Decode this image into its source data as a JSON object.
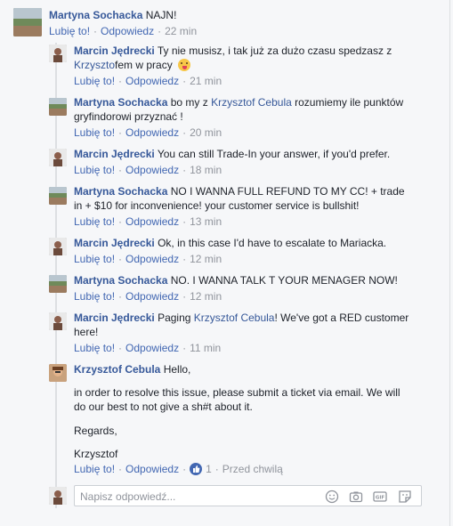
{
  "actions": {
    "like": "Lubię to!",
    "reply": "Odpowiedz",
    "separator": "·"
  },
  "comments": [
    {
      "author": "Martyna Sochacka",
      "text": "NAJN!",
      "time": "22 min"
    },
    {
      "author": "Marcin Jędrecki",
      "line1_pre": "Ty nie musisz, i tak już za dużo czasu spedzasz z",
      "line2_mention": "Krzyszto",
      "line2_post": "fem w pracy",
      "time": "21 min"
    },
    {
      "author": "Martyna Sochacka",
      "line1_pre": "bo my z",
      "line1_mention": "Krzysztof Cebula",
      "line1_post": "rozumiemy ile punktów",
      "line2": "gryfindorowi przyznać !",
      "time": "20 min"
    },
    {
      "author": "Marcin Jędrecki",
      "text": "You can still Trade-In your answer, if you'd prefer.",
      "time": "18 min"
    },
    {
      "author": "Martyna Sochacka",
      "line1": "NO I WANNA FULL REFUND TO MY CC! + trade",
      "line2": "in + $10 for inconvenience! your customer service is bullshit!",
      "time": "13 min"
    },
    {
      "author": "Marcin Jędrecki",
      "text": "Ok, in this case I'd have to escalate to Mariacka.",
      "time": "12 min"
    },
    {
      "author": "Martyna Sochacka",
      "text": "NO. I WANNA TALK T YOUR MENAGER NOW!",
      "time": "12 min"
    },
    {
      "author": "Marcin Jędrecki",
      "line1_pre": "Paging",
      "line1_mention": "Krzysztof Cebula",
      "line1_post": "! We've got a RED customer",
      "line2": "here!",
      "time": "11 min"
    },
    {
      "author": "Krzysztof Cebula",
      "text": "Hello,",
      "para1_line1": "in order to resolve this issue, please submit a ticket via email. We will",
      "para1_line2": "do our best to not give a sh#t about it.",
      "para2": "Regards,",
      "para3": "Krzysztof",
      "like_count": "1",
      "time": "Przed chwilą"
    }
  ],
  "reply_box": {
    "placeholder": "Napisz odpowiedź..."
  }
}
